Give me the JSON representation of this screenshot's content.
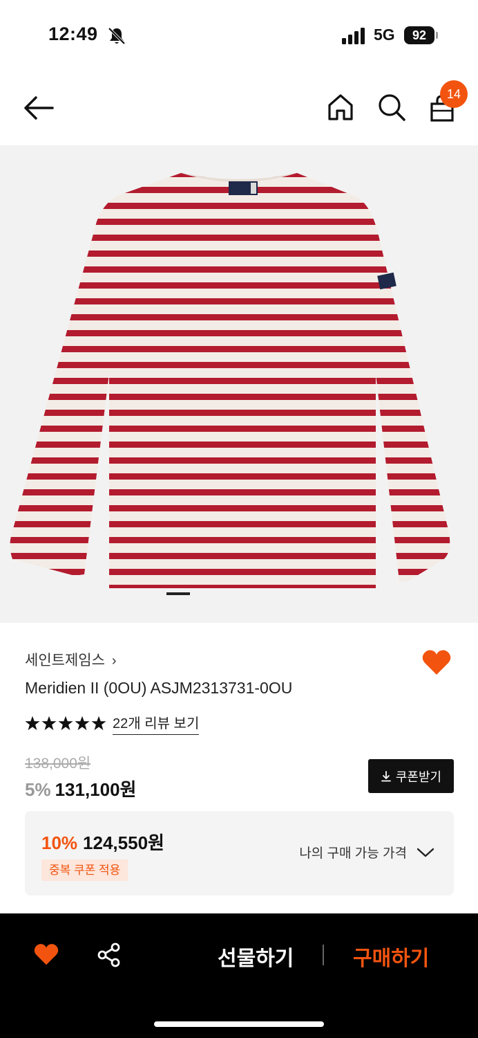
{
  "status_bar": {
    "time": "12:49",
    "network": "5G",
    "battery": "92"
  },
  "nav": {
    "cart_count": "14"
  },
  "product": {
    "brand": "세인트제임스",
    "brand_chevron": "›",
    "name": "Meridien II (0OU) ASJM2313731-0OU",
    "review_link": "22개 리뷰 보기",
    "rating": 5,
    "original_price": "138,000원",
    "discount_rate": "5%",
    "sale_price": "131,100원",
    "coupon_button": "쿠폰받기"
  },
  "my_price": {
    "discount_rate": "10%",
    "price": "124,550원",
    "coupon_tag": "중복 쿠폰 적용",
    "toggle_label": "나의 구매 가능 가격"
  },
  "bottom_bar": {
    "gift_label": "선물하기",
    "buy_label": "구매하기"
  },
  "colors": {
    "accent": "#f2540f",
    "stripe_red": "#b31b2e",
    "stripe_cream": "#f3ece6"
  },
  "icons": [
    "bell-slash-icon",
    "signal-icon",
    "back-arrow-icon",
    "home-icon",
    "search-icon",
    "shopping-bag-icon",
    "heart-icon",
    "star-icon",
    "download-icon",
    "chevron-down-icon",
    "share-icon"
  ]
}
